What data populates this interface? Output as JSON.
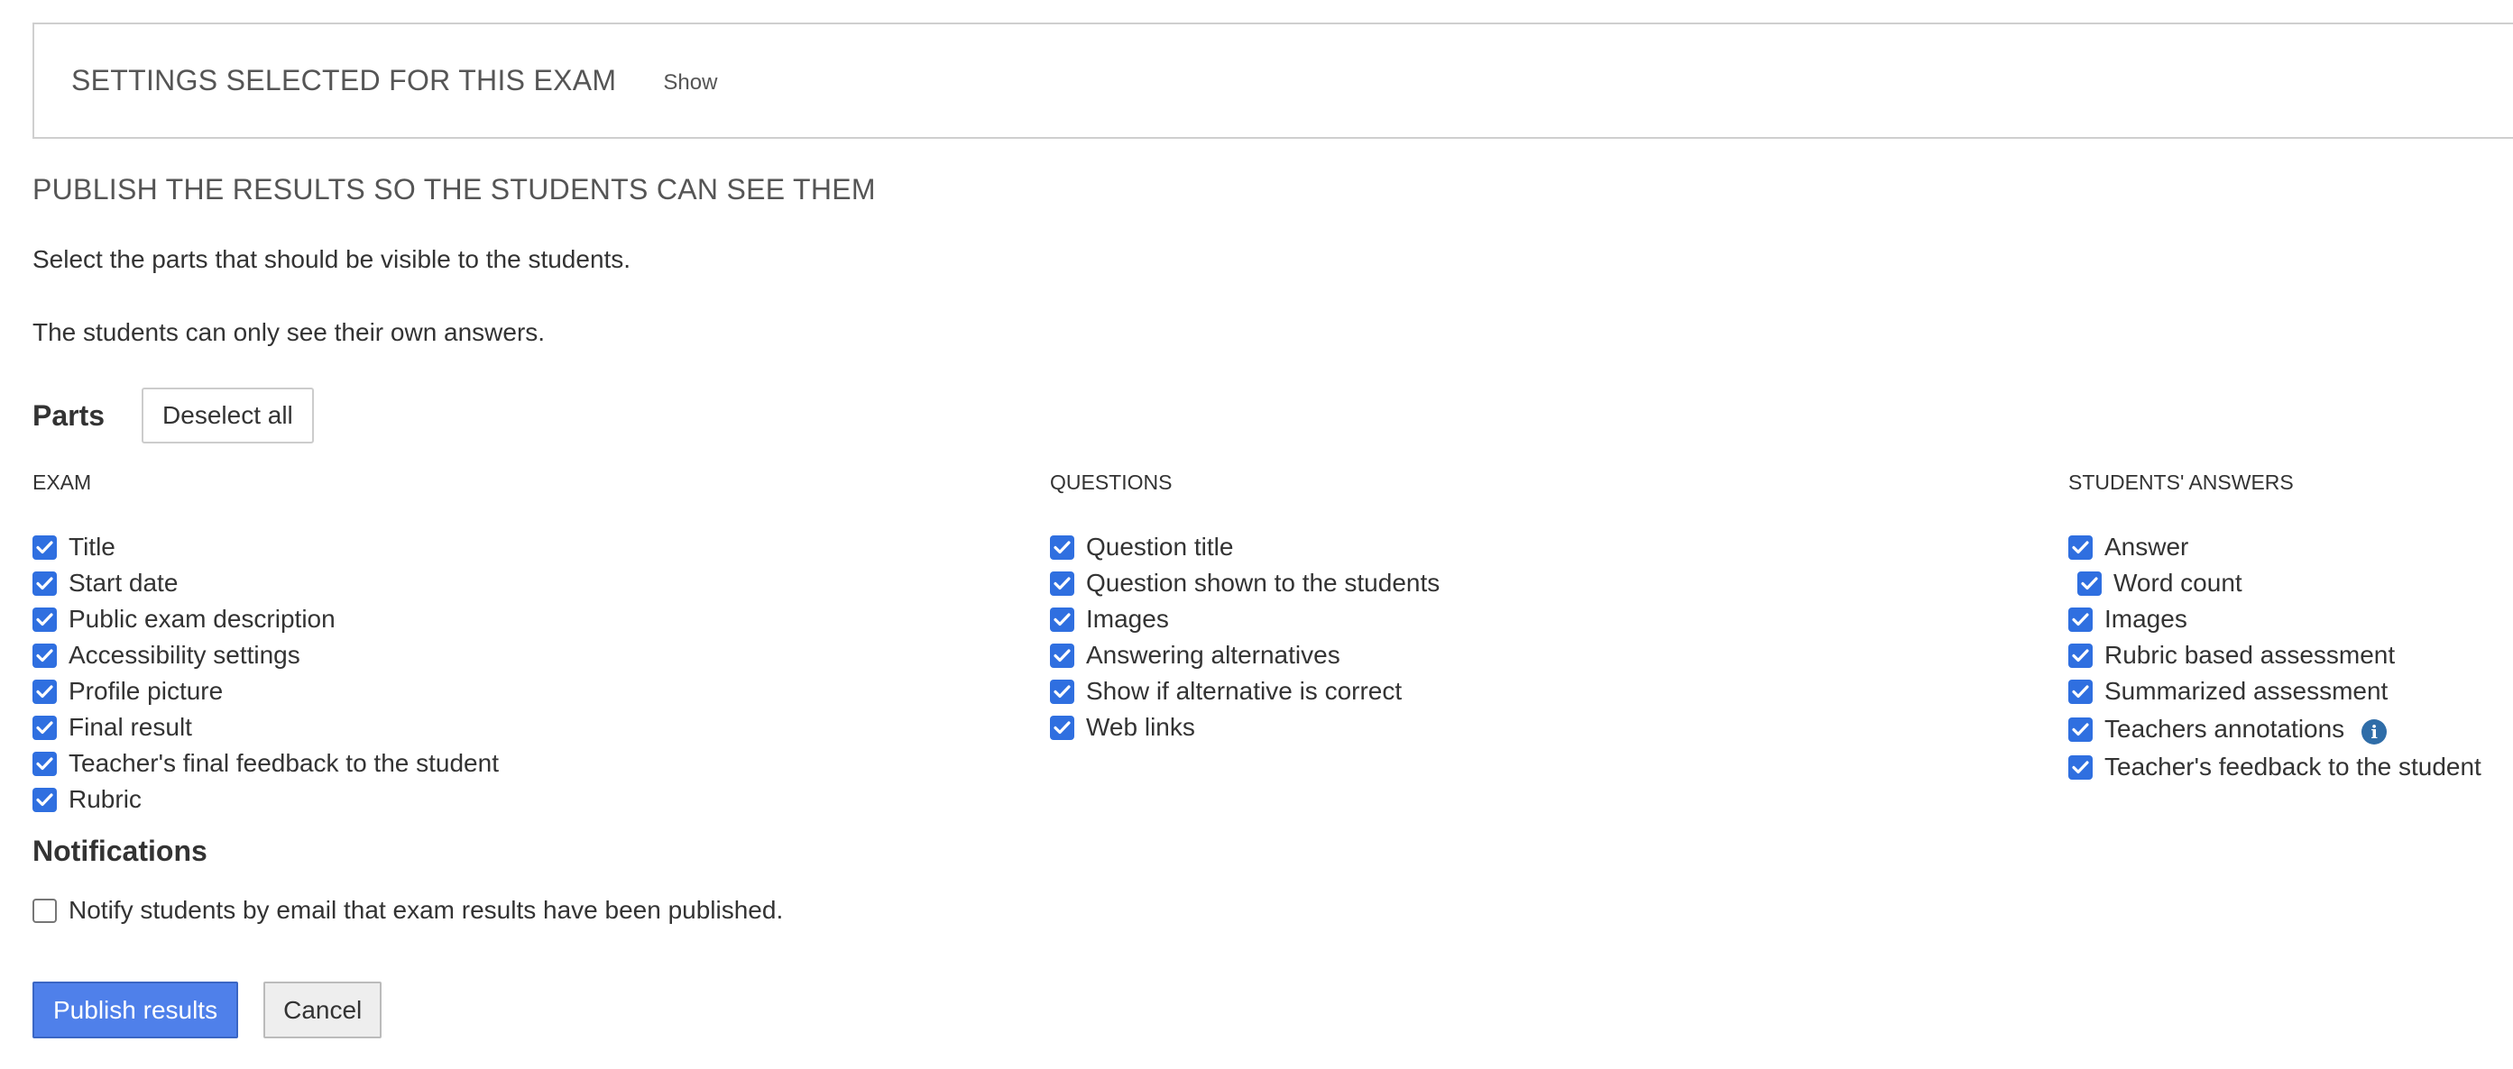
{
  "settings": {
    "title": "SETTINGS SELECTED FOR THIS EXAM",
    "toggle_label": "Show"
  },
  "publish": {
    "heading": "PUBLISH THE RESULTS SO THE STUDENTS CAN SEE THEM",
    "intro_select": "Select the parts that should be visible to the students.",
    "intro_own": "The students can only see their own answers."
  },
  "parts": {
    "title": "Parts",
    "deselect_label": "Deselect all",
    "checked_color": "#2f6fe0",
    "columns": [
      {
        "title": "EXAM",
        "items": [
          {
            "label": "Title",
            "checked": true
          },
          {
            "label": "Start date",
            "checked": true
          },
          {
            "label": "Public exam description",
            "checked": true
          },
          {
            "label": "Accessibility settings",
            "checked": true
          },
          {
            "label": "Profile picture",
            "checked": true
          },
          {
            "label": "Final result",
            "checked": true
          },
          {
            "label": "Teacher's final feedback to the student",
            "checked": true
          },
          {
            "label": "Rubric",
            "checked": true
          }
        ]
      },
      {
        "title": "QUESTIONS",
        "items": [
          {
            "label": "Question title",
            "checked": true
          },
          {
            "label": "Question shown to the students",
            "checked": true
          },
          {
            "label": "Images",
            "checked": true
          },
          {
            "label": "Answering alternatives",
            "checked": true
          },
          {
            "label": "Show if alternative is correct",
            "checked": true
          },
          {
            "label": "Web links",
            "checked": true
          }
        ]
      },
      {
        "title": "STUDENTS' ANSWERS",
        "items": [
          {
            "label": "Answer",
            "checked": true
          },
          {
            "label": "Word count",
            "checked": true
          },
          {
            "label": "Images",
            "checked": true
          },
          {
            "label": "Rubric based assessment",
            "checked": true
          },
          {
            "label": "Summarized assessment",
            "checked": true
          },
          {
            "label": "Teachers annotations",
            "checked": true,
            "icon": "info-icon"
          },
          {
            "label": "Teacher's feedback to the student",
            "checked": true
          }
        ]
      }
    ]
  },
  "notifications": {
    "heading": "Notifications",
    "email_label": "Notify students by email that exam results have been published.",
    "email_checked": false
  },
  "actions": {
    "publish_label": "Publish results",
    "cancel_label": "Cancel",
    "publish_color": "#4f80ea"
  }
}
